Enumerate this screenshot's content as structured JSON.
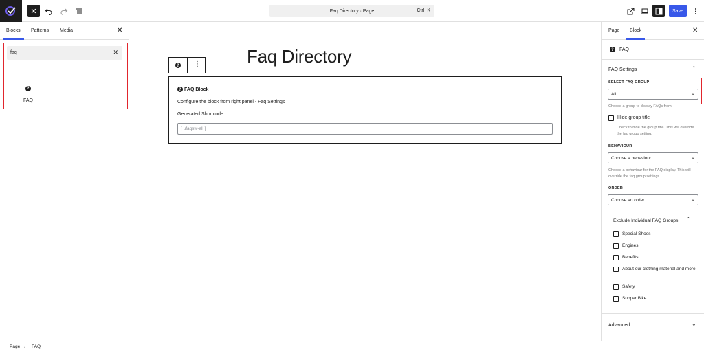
{
  "topbar": {
    "close_label": "✕",
    "doc_title": "Faq Directory · Page",
    "shortcut": "Ctrl+K",
    "save_label": "Save"
  },
  "inserter": {
    "tabs": [
      "Blocks",
      "Patterns",
      "Media"
    ],
    "search_value": "faq",
    "result_label": "FAQ"
  },
  "canvas": {
    "page_title": "Faq Directory",
    "block": {
      "title": "FAQ Block",
      "description": "Configure the block from right panel - Faq Settings",
      "generated_label": "Generated Shortcode",
      "shortcode_placeholder": "[ ufaqsw-all ]"
    }
  },
  "settings": {
    "tabs": [
      "Page",
      "Block"
    ],
    "block_name": "FAQ",
    "section_title": "FAQ Settings",
    "select_group_label": "SELECT FAQ GROUP",
    "select_group_value": "All",
    "select_group_help": "Choose a group to display FAQs from.",
    "hide_title_label": "Hide group title",
    "hide_title_help": "Check to hide the group title. This will override the faq group setting.",
    "behaviour_label": "BEHAVIOUR",
    "behaviour_value": "Choose a behaviour",
    "behaviour_help": "Choose a behaviour for the FAQ display. This will override the faq group settings.",
    "order_label": "ORDER",
    "order_value": "Choose an order",
    "exclude_title": "Exclude Individual FAQ Groups",
    "exclude_items": [
      "Special Shoes",
      "Engines",
      "Benefits",
      "About our clothing material and more",
      "Safety",
      "Supper Bike"
    ],
    "advanced_label": "Advanced"
  },
  "footer": {
    "crumbs": [
      "Page",
      "FAQ"
    ]
  },
  "colors": {
    "accent": "#3858e9",
    "highlight": "#e1262d"
  }
}
